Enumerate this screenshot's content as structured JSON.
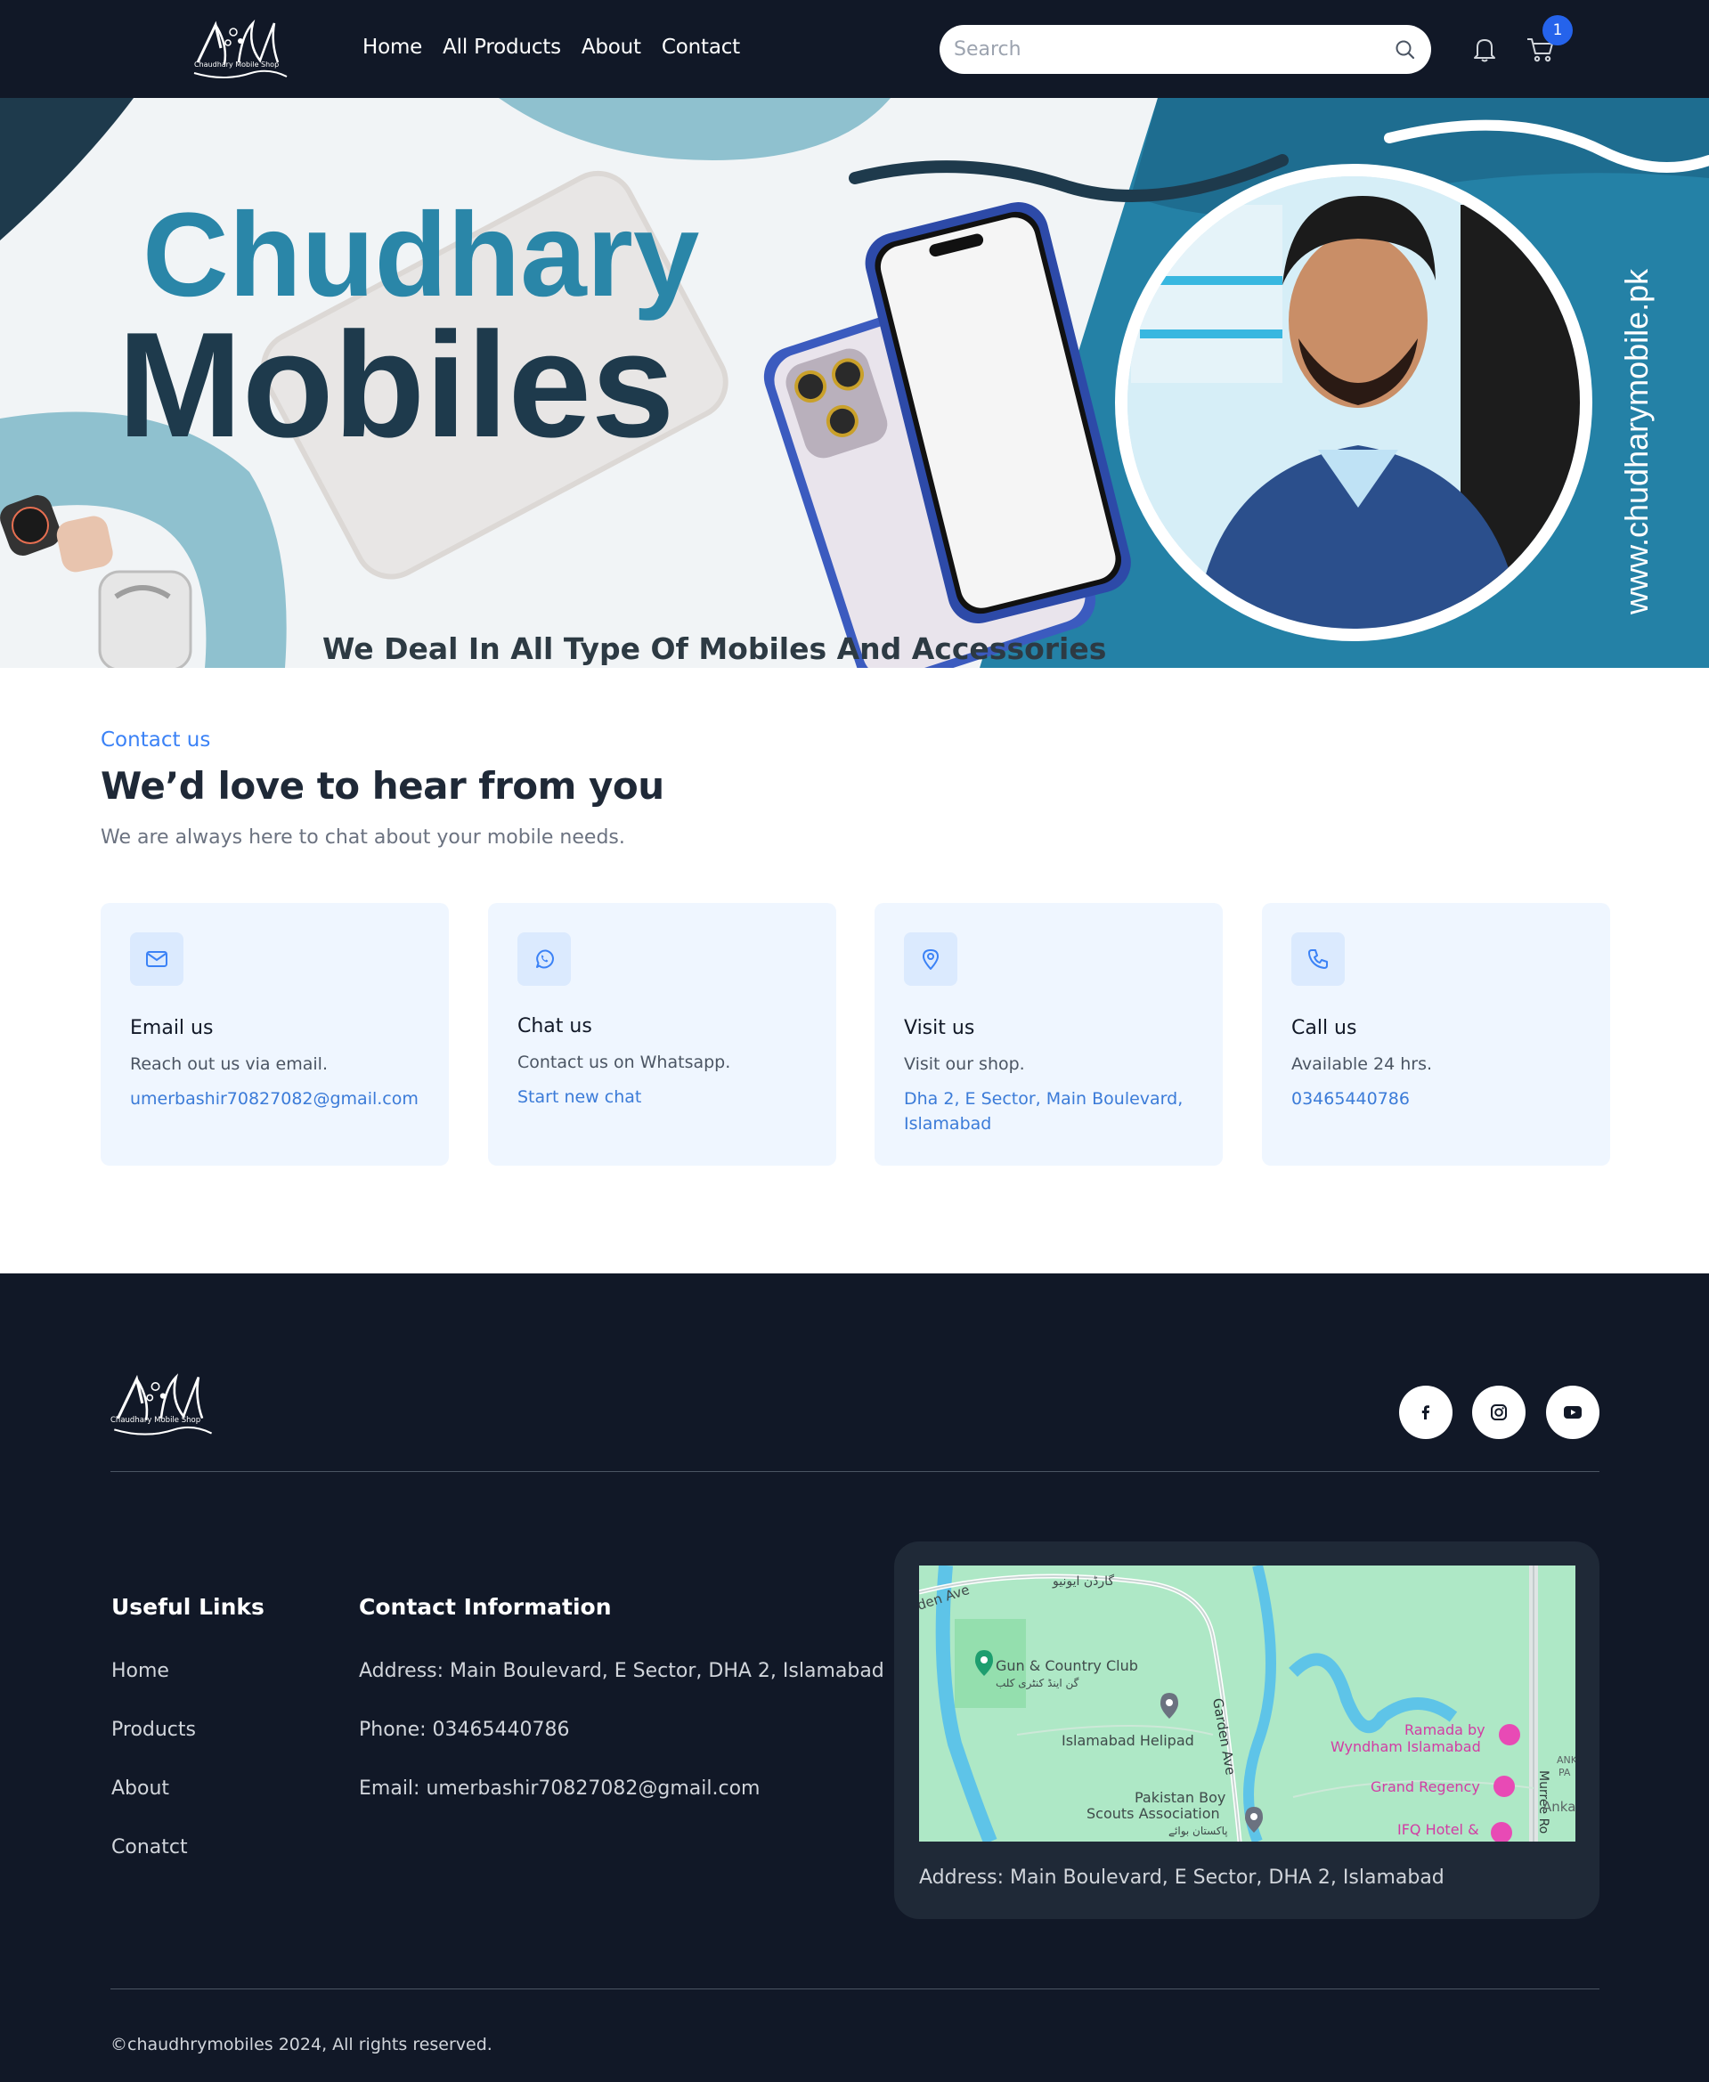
{
  "nav": {
    "logo_text": "Chaudhary Mobile Shop",
    "links": [
      "Home",
      "All Products",
      "About",
      "Contact"
    ],
    "search_placeholder": "Search",
    "cart_count": "1"
  },
  "hero": {
    "title_line1": "Chudhary",
    "title_line2": "Mobiles",
    "tagline": "We Deal In All Type Of Mobiles And Accessories",
    "website": "www.chudharymobile.pk"
  },
  "contact": {
    "eyebrow": "Contact us",
    "title": "We’d love to hear from you",
    "subtitle": "We are always here to chat about your mobile needs.",
    "cards": [
      {
        "icon": "mail-icon",
        "title": "Email us",
        "desc": "Reach out us via email.",
        "link": "umerbashir70827082@gmail.com"
      },
      {
        "icon": "whatsapp-icon",
        "title": "Chat us",
        "desc": "Contact us on Whatsapp.",
        "link": "Start new chat"
      },
      {
        "icon": "map-pin-icon",
        "title": "Visit us",
        "desc": "Visit our shop.",
        "link": "Dha 2, E Sector, Main Boulevard, Islamabad"
      },
      {
        "icon": "phone-icon",
        "title": "Call us",
        "desc": "Available 24 hrs.",
        "link": "03465440786"
      }
    ]
  },
  "footer": {
    "logo_text": "Chaudhary Mobile Shop",
    "social": [
      "facebook-icon",
      "instagram-icon",
      "youtube-icon"
    ],
    "useful_links_heading": "Useful Links",
    "useful_links": [
      "Home",
      "Products",
      "About",
      "Conatct"
    ],
    "contact_heading": "Contact Information",
    "contact_address": "Address: Main Boulevard, E Sector, DHA 2, Islamabad",
    "contact_phone": "Phone: 03465440786",
    "contact_email": "Email: umerbashir70827082@gmail.com",
    "map": {
      "labels": {
        "road_top": "den Ave",
        "road_top_urdu": "گارڈن ایونیو",
        "gun_club": "Gun & Country Club",
        "gun_club_urdu": "گن اینڈ کنٹری کلب",
        "helipad": "Islamabad Helipad",
        "garden_ave": "Garden Ave",
        "ramada_1": "Ramada by",
        "ramada_2": "Wyndham Islamabad",
        "grand_regency": "Grand Regency",
        "scouts_1": "Pakistan Boy",
        "scouts_2": "Scouts Association",
        "scouts_urdu": "پاکستان بوائے",
        "ifq": "IFQ Hotel &",
        "murree": "Murree Ro",
        "anka": "Anka",
        "ank": "ANK",
        "pa": "PA"
      },
      "address": "Address: Main Boulevard, E Sector, DHA 2, Islamabad"
    },
    "copyright": "©chaudhrymobiles 2024, All rights reserved."
  },
  "colors": {
    "nav_bg": "#111827",
    "accent": "#2563eb",
    "card_bg": "#eff6ff",
    "link": "#3b7bd8",
    "hero_teal": "#2481a6",
    "hero_navy": "#1e3a4c"
  }
}
